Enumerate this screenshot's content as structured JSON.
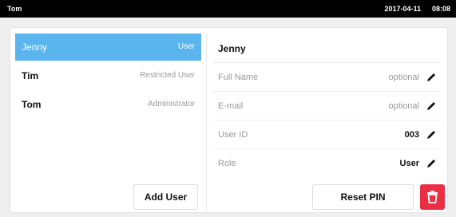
{
  "topbar": {
    "user": "Tom",
    "date": "2017-04-11",
    "time": "08:08"
  },
  "users": [
    {
      "name": "Jenny",
      "role": "User"
    },
    {
      "name": "Tim",
      "role": "Restricted User"
    },
    {
      "name": "Tom",
      "role": "Administrator"
    }
  ],
  "buttons": {
    "add_user": "Add User",
    "reset_pin": "Reset PIN"
  },
  "detail": {
    "title": "Jenny",
    "fields": [
      {
        "label": "Full Name",
        "value": "optional"
      },
      {
        "label": "E-mail",
        "value": "optional"
      },
      {
        "label": "User ID",
        "value": "003"
      },
      {
        "label": "Role",
        "value": "User"
      }
    ]
  },
  "colors": {
    "accent": "#5ab4ee",
    "danger": "#ea2f45",
    "topbar": "#000000"
  },
  "icons": {
    "edit": "pencil-icon",
    "delete": "trash-icon"
  }
}
